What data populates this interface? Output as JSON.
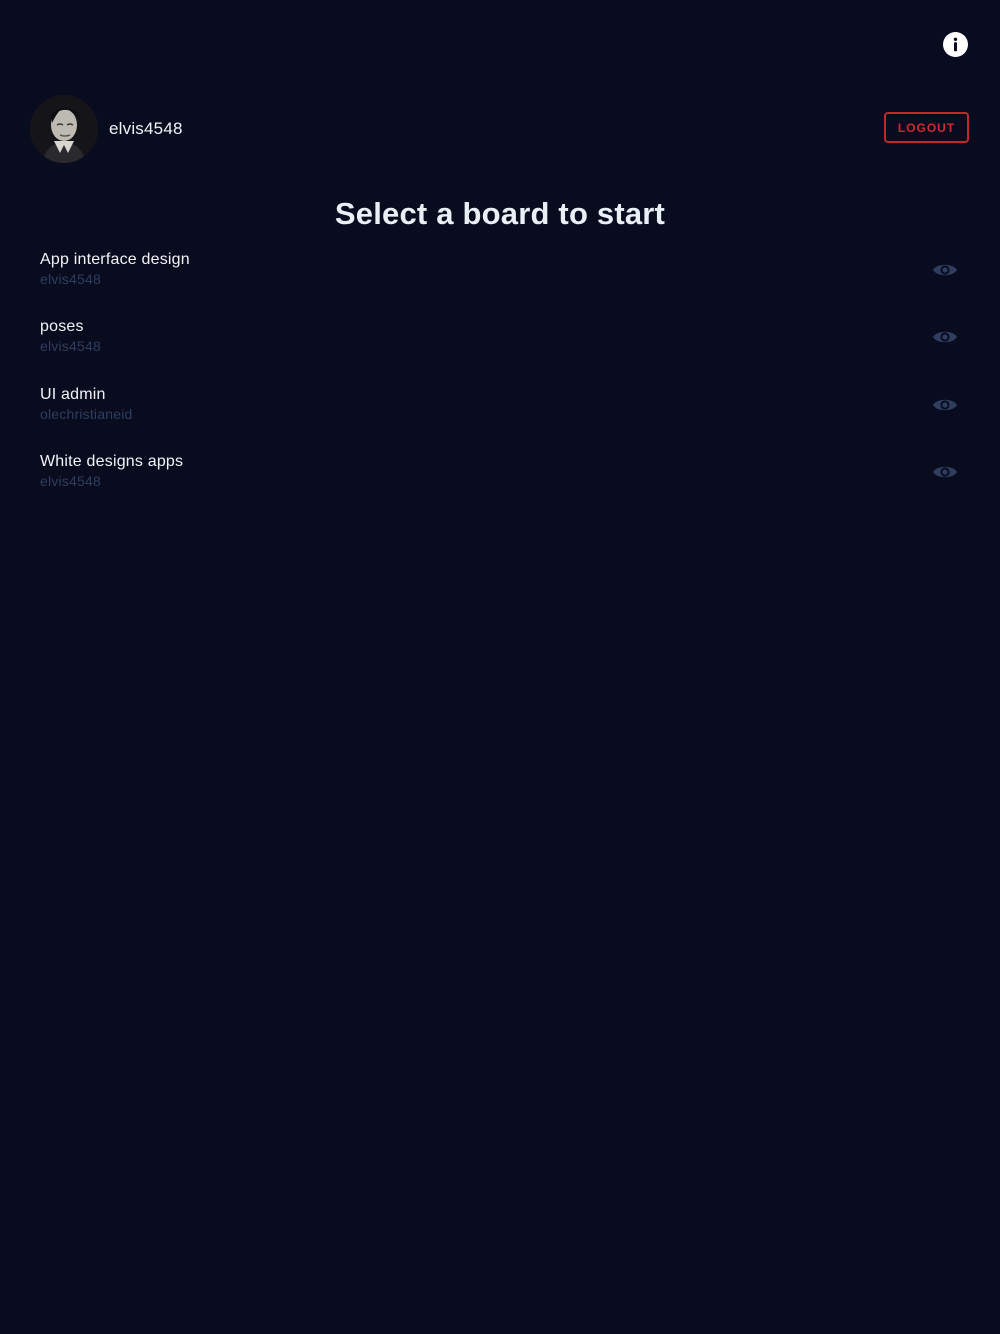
{
  "header": {
    "info_icon": "info-icon",
    "logout_label": "LOGOUT",
    "logout_color": "#c4262b"
  },
  "profile": {
    "username": "elvis4548",
    "avatar_icon": "avatar"
  },
  "page": {
    "title": "Select a board to start",
    "background": "#090b1f"
  },
  "boards": [
    {
      "name": "App interface design",
      "owner": "elvis4548",
      "icon": "eye-icon"
    },
    {
      "name": "poses",
      "owner": "elvis4548",
      "icon": "eye-icon"
    },
    {
      "name": "UI admin",
      "owner": "olechristianeid",
      "icon": "eye-icon"
    },
    {
      "name": "White designs apps",
      "owner": "elvis4548",
      "icon": "eye-icon"
    }
  ]
}
